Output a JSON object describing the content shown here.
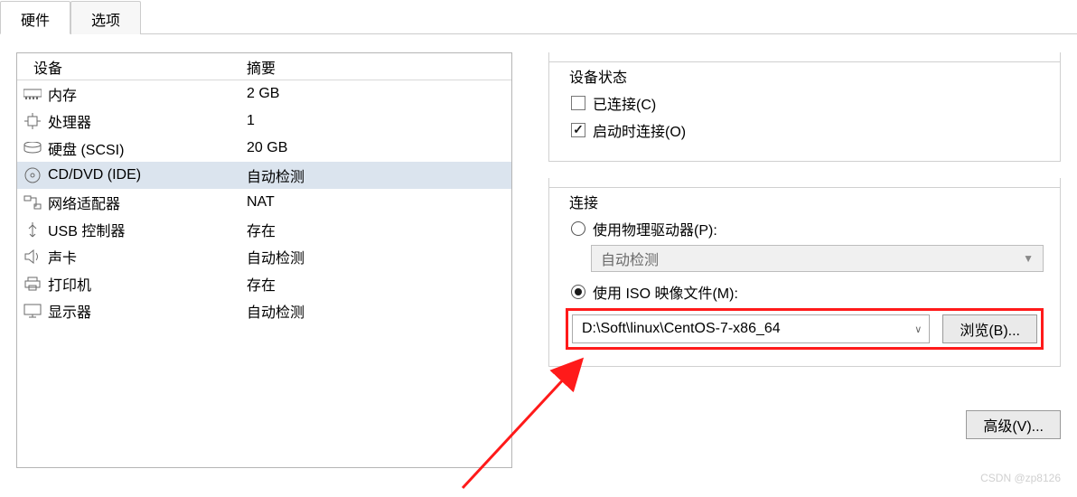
{
  "tabs": {
    "hardware": "硬件",
    "options": "选项"
  },
  "table": {
    "headers": {
      "device": "设备",
      "summary": "摘要"
    },
    "rows": [
      {
        "name": "内存",
        "summary": "2 GB",
        "icon": "memory-icon"
      },
      {
        "name": "处理器",
        "summary": "1",
        "icon": "cpu-icon"
      },
      {
        "name": "硬盘 (SCSI)",
        "summary": "20 GB",
        "icon": "disk-icon"
      },
      {
        "name": "CD/DVD (IDE)",
        "summary": "自动检测",
        "icon": "cd-icon"
      },
      {
        "name": "网络适配器",
        "summary": "NAT",
        "icon": "network-icon"
      },
      {
        "name": "USB 控制器",
        "summary": "存在",
        "icon": "usb-icon"
      },
      {
        "name": "声卡",
        "summary": "自动检测",
        "icon": "sound-icon"
      },
      {
        "name": "打印机",
        "summary": "存在",
        "icon": "printer-icon"
      },
      {
        "name": "显示器",
        "summary": "自动检测",
        "icon": "display-icon"
      }
    ]
  },
  "status": {
    "legend": "设备状态",
    "connected": "已连接(C)",
    "connect_on_poweron": "启动时连接(O)"
  },
  "connection": {
    "legend": "连接",
    "use_physical": "使用物理驱动器(P):",
    "physical_value": "自动检测",
    "use_iso": "使用 ISO 映像文件(M):",
    "iso_value": "D:\\Soft\\linux\\CentOS-7-x86_64",
    "browse": "浏览(B)..."
  },
  "advanced": "高级(V)...",
  "watermark": "CSDN @zp8126"
}
